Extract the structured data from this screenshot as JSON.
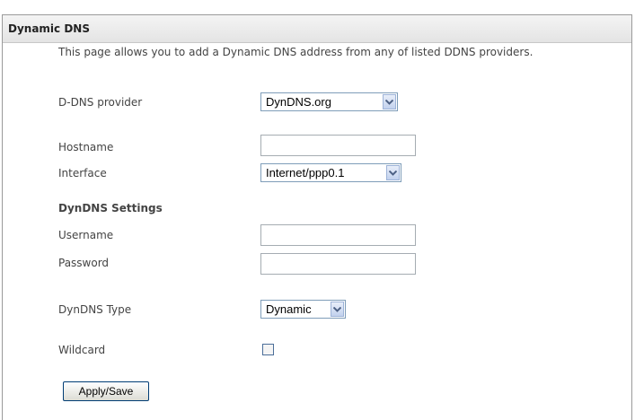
{
  "panel": {
    "title": "Dynamic DNS",
    "description": "This page allows you to add a Dynamic DNS address from any of listed DDNS providers."
  },
  "form": {
    "provider_label": "D-DNS provider",
    "provider_value": "DynDNS.org",
    "hostname_label": "Hostname",
    "hostname_value": "",
    "interface_label": "Interface",
    "interface_value": "Internet/ppp0.1",
    "settings_title": "DynDNS Settings",
    "username_label": "Username",
    "username_value": "",
    "password_label": "Password",
    "password_value": "",
    "type_label": "DynDNS Type",
    "type_value": "Dynamic",
    "wildcard_label": "Wildcard",
    "wildcard_checked": false,
    "apply_label": "Apply/Save"
  },
  "icons": {
    "dropdown_arrow": "chevron-down-icon"
  },
  "colors": {
    "header_bg": "#e8e8e8",
    "select_border": "#7f9db9",
    "arrow_blue": "#4d6185"
  }
}
